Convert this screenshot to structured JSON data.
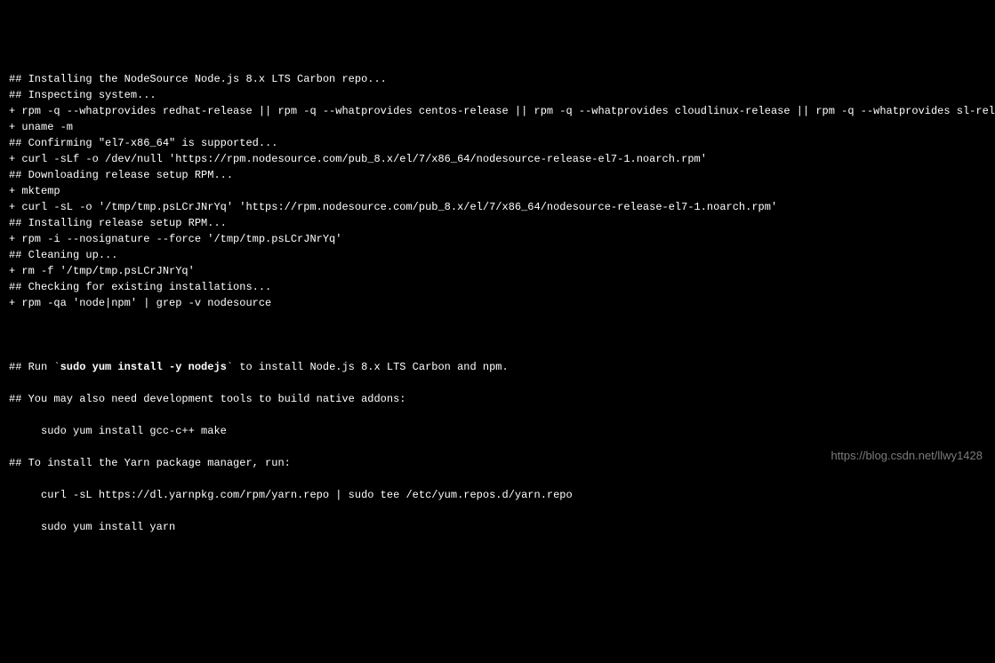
{
  "terminal": {
    "lines": [
      {
        "text": "## Installing the NodeSource Node.js 8.x LTS Carbon repo...",
        "blank_after": true
      },
      {
        "text": "",
        "blank_after": false
      },
      {
        "text": "## Inspecting system...",
        "blank_after": true
      },
      {
        "text": "+ rpm -q --whatprovides redhat-release || rpm -q --whatprovides centos-release || rpm -q --whatprovides cloudlinux-release || rpm -q --whatprovides sl-release",
        "blank_after": false
      },
      {
        "text": "+ uname -m",
        "blank_after": true
      },
      {
        "text": "## Confirming \"el7-x86_64\" is supported...",
        "blank_after": true
      },
      {
        "text": "+ curl -sLf -o /dev/null 'https://rpm.nodesource.com/pub_8.x/el/7/x86_64/nodesource-release-el7-1.noarch.rpm'",
        "blank_after": true
      },
      {
        "text": "## Downloading release setup RPM...",
        "blank_after": true
      },
      {
        "text": "+ mktemp",
        "blank_after": false
      },
      {
        "text": "+ curl -sL -o '/tmp/tmp.psLCrJNrYq' 'https://rpm.nodesource.com/pub_8.x/el/7/x86_64/nodesource-release-el7-1.noarch.rpm'",
        "blank_after": true
      },
      {
        "text": "## Installing release setup RPM...",
        "blank_after": true
      },
      {
        "text": "+ rpm -i --nosignature --force '/tmp/tmp.psLCrJNrYq'",
        "blank_after": true
      },
      {
        "text": "## Cleaning up...",
        "blank_after": true
      },
      {
        "text": "+ rm -f '/tmp/tmp.psLCrJNrYq'",
        "blank_after": true
      },
      {
        "text": "## Checking for existing installations...",
        "blank_after": true
      },
      {
        "text": "+ rpm -qa 'node|npm' | grep -v nodesource",
        "blank_after": true
      }
    ],
    "final_block": {
      "run_prefix": "## Run `",
      "run_bold": "sudo yum install -y nodejs",
      "run_suffix": "` to install Node.js 8.x LTS Carbon and npm.",
      "line2": "## You may also need development tools to build native addons:",
      "line3": "     sudo yum install gcc-c++ make",
      "line4": "## To install the Yarn package manager, run:",
      "line5": "     curl -sL https://dl.yarnpkg.com/rpm/yarn.repo | sudo tee /etc/yum.repos.d/yarn.repo",
      "line6": "     sudo yum install yarn"
    }
  },
  "watermark": "https://blog.csdn.net/llwy1428"
}
